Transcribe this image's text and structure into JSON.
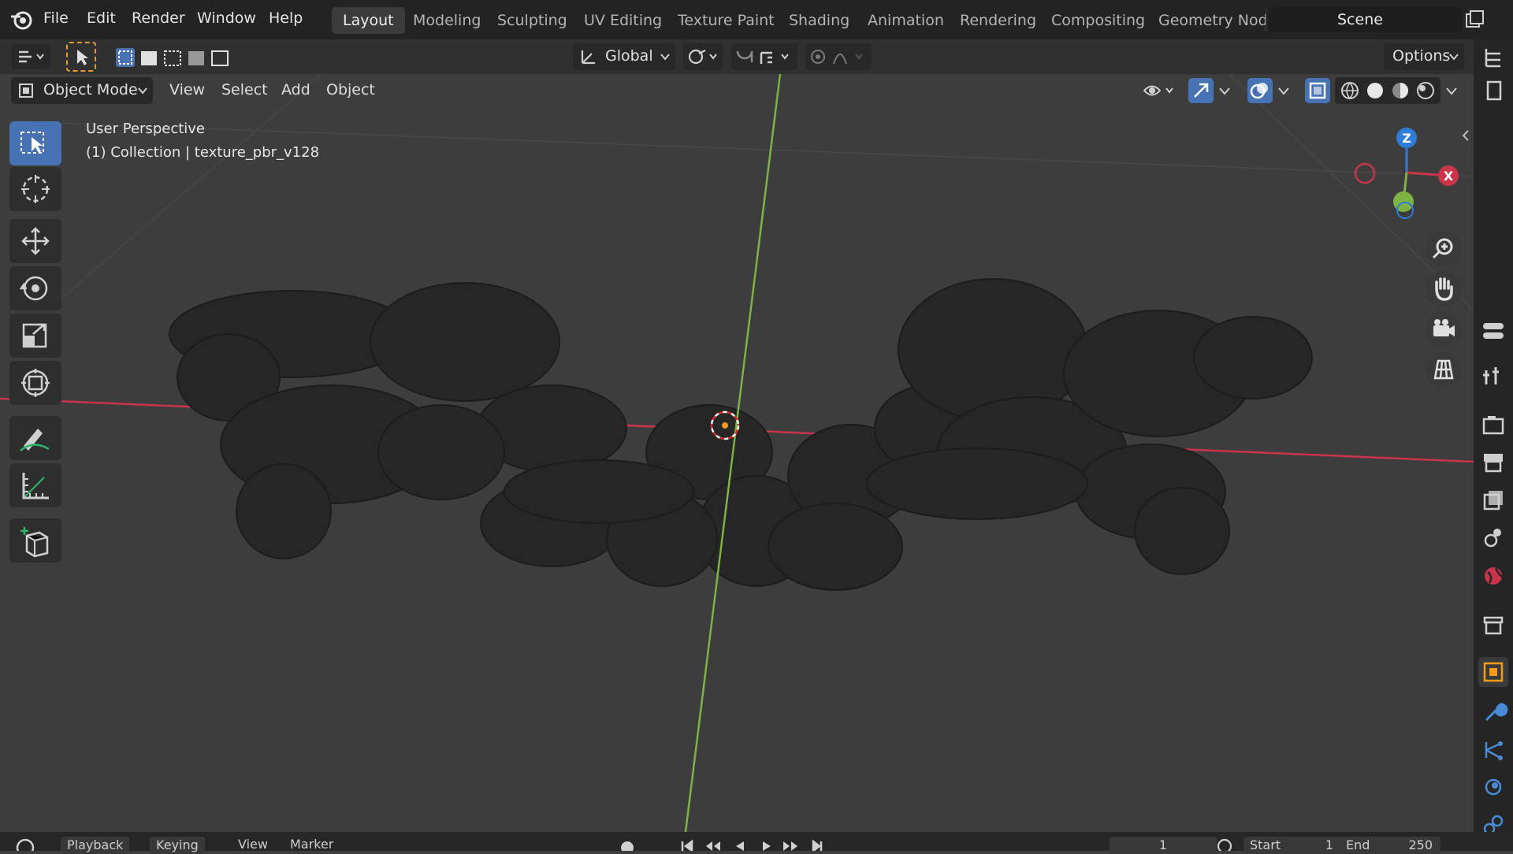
{
  "menu": {
    "file": "File",
    "edit": "Edit",
    "render": "Render",
    "window": "Window",
    "help": "Help"
  },
  "workspaces": [
    "Layout",
    "Modeling",
    "Sculpting",
    "UV Editing",
    "Texture Paint",
    "Shading",
    "Animation",
    "Rendering",
    "Compositing",
    "Geometry Nod"
  ],
  "scene": {
    "name": "Scene"
  },
  "tool_header": {
    "orientation": "Global",
    "options": "Options"
  },
  "viewport_header": {
    "mode": "Object Mode",
    "view": "View",
    "select": "Select",
    "add": "Add",
    "object": "Object"
  },
  "overlay": {
    "perspective": "User Perspective",
    "collection": "(1) Collection | texture_pbr_v128"
  },
  "gizmo": {
    "z": "Z",
    "x": "X"
  },
  "timeline": {
    "playback": "Playback",
    "keying": "Keying",
    "view": "View",
    "marker": "Marker",
    "current_frame": "1",
    "start_label": "Start",
    "start_value": "1",
    "end_label": "End",
    "end_value": "250"
  },
  "colors": {
    "accent": "#4772b3",
    "x_axis": "#c9344b",
    "y_axis": "#7cb342",
    "z_axis": "#2f7bd8",
    "object": "#262626"
  }
}
